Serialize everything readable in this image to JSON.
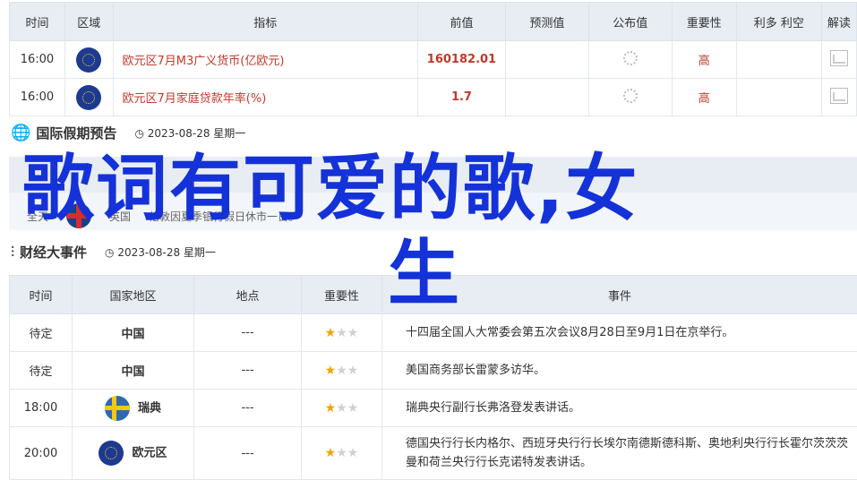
{
  "top_table": {
    "headers": [
      "时间",
      "区域",
      "指标",
      "前值",
      "预测值",
      "公布值",
      "重要性",
      "利多 利空",
      "解读"
    ],
    "rows": [
      {
        "time": "16:00",
        "indicator": "欧元区7月M3广义货币(亿欧元)",
        "prev": "160182.01",
        "importance": "高"
      },
      {
        "time": "16:00",
        "indicator": "欧元区7月家庭贷款年率(%)",
        "prev": "1.7",
        "importance": "高"
      }
    ]
  },
  "holiday_section": {
    "title": "国际假期预告",
    "date": "2023-08-28 星期一"
  },
  "holiday_row": {
    "time": "全天",
    "region": "英国",
    "text": "伦敦因夏季银行假日休市一日。"
  },
  "econ_section": {
    "title": "财经大事件",
    "date": "2023-08-28 星期一"
  },
  "event_table": {
    "headers": [
      "时间",
      "国家地区",
      "地点",
      "重要性",
      "事件"
    ],
    "rows": [
      {
        "time": "待定",
        "region": "中国",
        "place": "---",
        "stars": 1,
        "event": "十四届全国人大常委会第五次会议8月28日至9月1日在京举行。"
      },
      {
        "time": "待定",
        "region": "中国",
        "place": "---",
        "stars": 1,
        "event": "美国商务部长雷蒙多访华。"
      },
      {
        "time": "18:00",
        "region": "瑞典",
        "place": "---",
        "stars": 1,
        "event": "瑞典央行副行长弗洛登发表讲话。"
      },
      {
        "time": "20:00",
        "region": "欧元区",
        "place": "---",
        "stars": 1,
        "event": "德国央行行长内格尔、西班牙央行行长埃尔南德斯德科斯、奥地利央行行长霍尔茨茨茨曼和荷兰央行行长克诺特发表讲话。"
      }
    ]
  },
  "overlay_title": {
    "line1": "歌词有可爱的歌,女",
    "line2": "生"
  },
  "colors": {
    "accent_red": "#c0392b",
    "overlay_blue": "#1432d8",
    "header_bg": "#e8edf4",
    "star": "#f0a500"
  }
}
